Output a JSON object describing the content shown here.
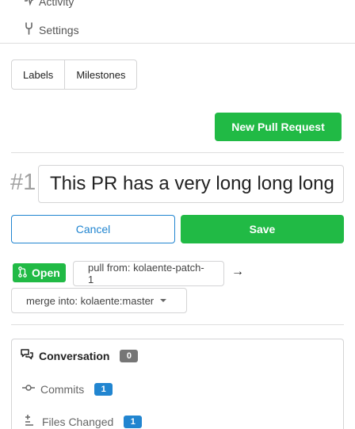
{
  "nav": {
    "activity_label": "Activity",
    "settings_label": "Settings"
  },
  "filters": {
    "labels": "Labels",
    "milestones": "Milestones"
  },
  "new_pr_button": "New Pull Request",
  "pr": {
    "index": "#1",
    "title": "This PR has a very long long long"
  },
  "actions": {
    "cancel": "Cancel",
    "save": "Save"
  },
  "status": {
    "state": "Open",
    "pull_from": "pull from: kolaente-patch-1",
    "merge_into": "merge into: kolaente:master"
  },
  "tabs": [
    {
      "label": "Conversation",
      "count": "0"
    },
    {
      "label": "Commits",
      "count": "1"
    },
    {
      "label": "Files Changed",
      "count": "1"
    }
  ],
  "colors": {
    "primary_green": "#21ba45",
    "primary_blue": "#2185d0",
    "count_grey": "#767676"
  }
}
